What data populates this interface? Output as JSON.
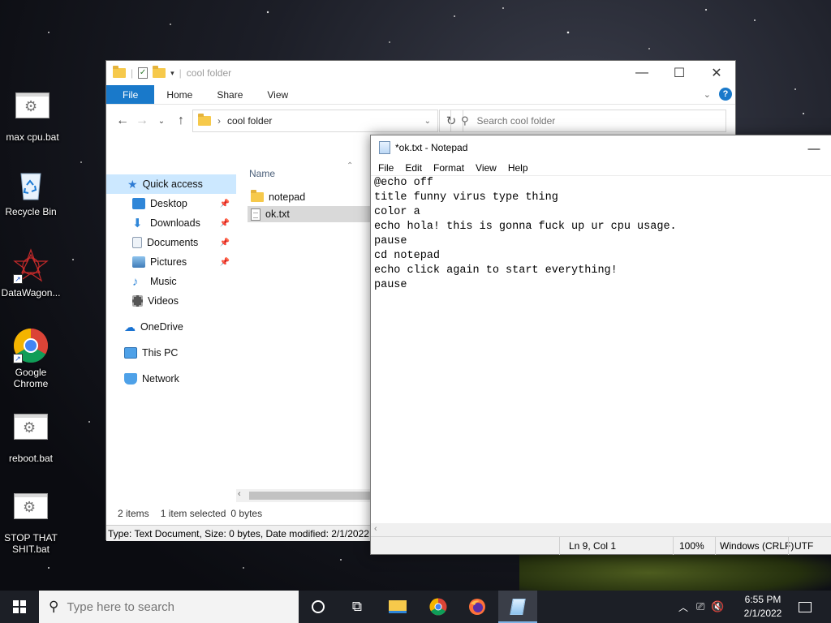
{
  "desktop": {
    "icons": [
      {
        "label": "max cpu.bat",
        "icon": "bat-file-icon"
      },
      {
        "label": "Recycle Bin",
        "icon": "recycle-bin-icon"
      },
      {
        "label": "DataWagon...",
        "icon": "datawagon-icon"
      },
      {
        "label": "Google Chrome",
        "icon": "chrome-icon"
      },
      {
        "label": "reboot.bat",
        "icon": "bat-file-icon"
      },
      {
        "label": "STOP THAT SHIT.bat",
        "icon": "bat-file-icon"
      }
    ]
  },
  "explorer": {
    "title": "cool folder",
    "ribbon_tabs": [
      "File",
      "Home",
      "Share",
      "View"
    ],
    "address_path": "cool folder",
    "search_placeholder": "Search cool folder",
    "nav": {
      "quick_access": "Quick access",
      "items": [
        {
          "label": "Desktop",
          "icon": "desktop-icon",
          "pinned": true
        },
        {
          "label": "Downloads",
          "icon": "downloads-icon",
          "pinned": true
        },
        {
          "label": "Documents",
          "icon": "documents-icon",
          "pinned": true
        },
        {
          "label": "Pictures",
          "icon": "pictures-icon",
          "pinned": true
        },
        {
          "label": "Music",
          "icon": "music-icon",
          "pinned": false
        },
        {
          "label": "Videos",
          "icon": "videos-icon",
          "pinned": false
        }
      ],
      "onedrive": "OneDrive",
      "this_pc": "This PC",
      "network": "Network"
    },
    "column_header": "Name",
    "files": [
      {
        "name": "notepad",
        "type": "folder",
        "selected": false
      },
      {
        "name": "ok.txt",
        "type": "text",
        "selected": true
      }
    ],
    "status": {
      "items": "2 items",
      "selected": "1 item selected",
      "size": "0 bytes"
    },
    "detail_bar": "Type: Text Document, Size: 0 bytes, Date modified: 2/1/2022 6:"
  },
  "notepad": {
    "title": "*ok.txt - Notepad",
    "menu": [
      "File",
      "Edit",
      "Format",
      "View",
      "Help"
    ],
    "content": "@echo off\ntitle funny virus type thing\ncolor a\necho hola! this is gonna fuck up ur cpu usage.\npause\ncd notepad\necho click again to start everything!\npause",
    "status": {
      "position": "Ln 9, Col 1",
      "zoom": "100%",
      "line_endings": "Windows (CRLF)",
      "encoding": "UTF"
    }
  },
  "taskbar": {
    "search_placeholder": "Type here to search",
    "time": "6:55 PM",
    "date": "2/1/2022"
  },
  "colors": {
    "accent": "#1979ca",
    "selection": "#cce8ff",
    "taskbar": "#1c1f26"
  }
}
